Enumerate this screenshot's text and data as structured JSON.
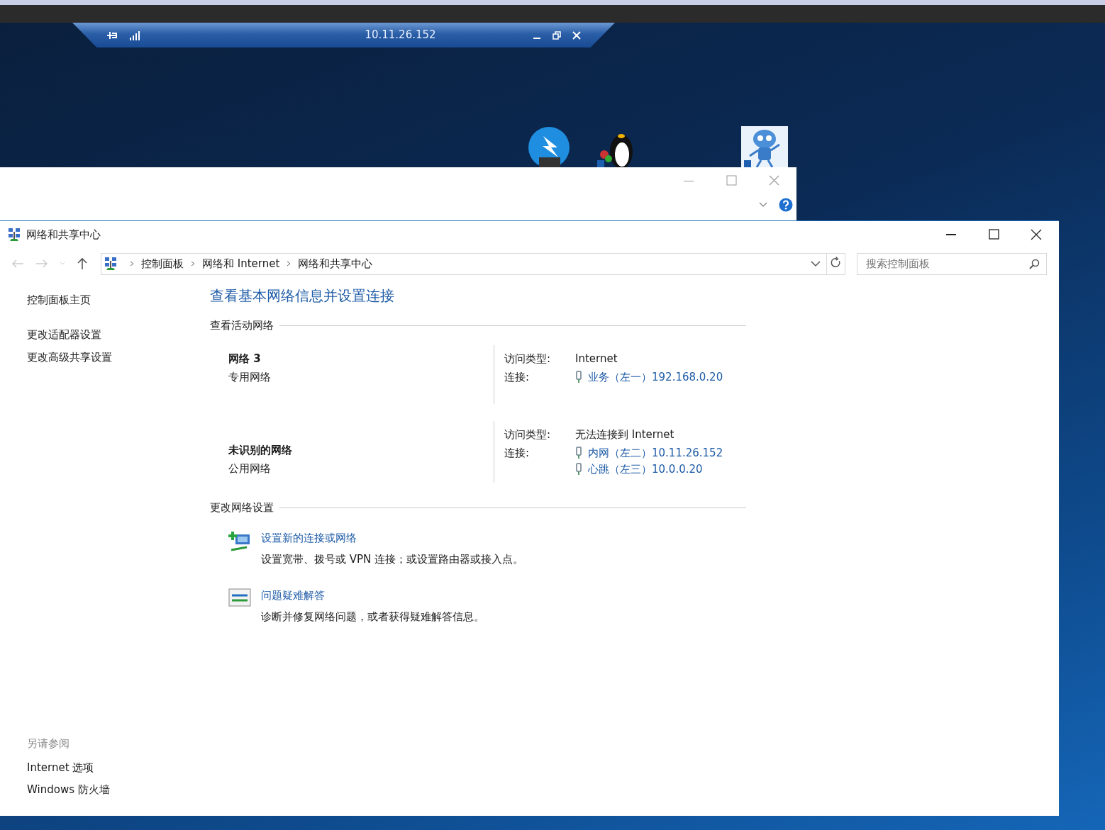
{
  "remote_bar": {
    "title": "10.11.26.152"
  },
  "window": {
    "title": "网络和共享中心"
  },
  "breadcrumb": [
    "控制面板",
    "网络和 Internet",
    "网络和共享中心"
  ],
  "search": {
    "placeholder": "搜索控制面板"
  },
  "sidebar": {
    "items": [
      "控制面板主页",
      "更改适配器设置",
      "更改高级共享设置"
    ],
    "see_also_heading": "另请参阅",
    "see_also": [
      "Internet 选项",
      "Windows 防火墙"
    ]
  },
  "heading": "查看基本网络信息并设置连接",
  "active_networks": {
    "heading": "查看活动网络",
    "networks": [
      {
        "name": "网络 3",
        "type": "专用网络",
        "access_label": "访问类型:",
        "access": "Internet",
        "connection_label": "连接:",
        "connections": [
          "业务（左一）192.168.0.20"
        ]
      },
      {
        "name": "未识别的网络",
        "type": "公用网络",
        "access_label": "访问类型:",
        "access": "无法连接到 Internet",
        "connection_label": "连接:",
        "connections": [
          "内网（左二）10.11.26.152",
          "心跳（左三）10.0.0.20"
        ]
      }
    ]
  },
  "change_settings": {
    "heading": "更改网络设置",
    "tasks": [
      {
        "kind": "new_connection",
        "link": "设置新的连接或网络",
        "description": "设置宽带、拨号或 VPN 连接；或设置路由器或接入点。"
      },
      {
        "kind": "troubleshoot",
        "link": "问题疑难解答",
        "description": "诊断并修复网络问题，或者获得疑难解答信息。"
      }
    ]
  }
}
